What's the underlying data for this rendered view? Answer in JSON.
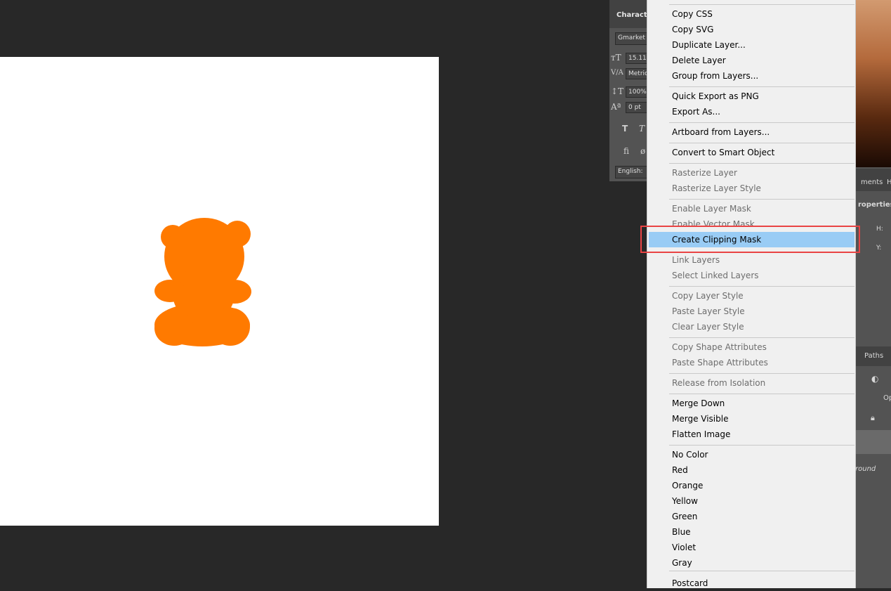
{
  "character_panel": {
    "tab_title": "Character",
    "font_family": "Gmarket S",
    "font_size": "15.11",
    "kerning": "Metric",
    "vertical_scale": "100%",
    "baseline_shift": "0 pt",
    "language": "English:"
  },
  "right_panel": {
    "adjustments_tab": "ments",
    "h_tab": "H",
    "properties_label": "roperties",
    "h_label": "H:",
    "y_label": "Y:",
    "paths_tab": "Paths",
    "opacity_label": "Op",
    "background_layer_label": "round"
  },
  "menu": {
    "items": [
      {
        "label": "Copy CSS",
        "enabled": true
      },
      {
        "label": "Copy SVG",
        "enabled": true
      },
      {
        "label": "Duplicate Layer...",
        "enabled": true
      },
      {
        "label": "Delete Layer",
        "enabled": true
      },
      {
        "label": "Group from Layers...",
        "enabled": true
      },
      {
        "label": "Quick Export as PNG",
        "enabled": true
      },
      {
        "label": "Export As...",
        "enabled": true
      },
      {
        "label": "Artboard from Layers...",
        "enabled": true
      },
      {
        "label": "Convert to Smart Object",
        "enabled": true
      },
      {
        "label": "Rasterize Layer",
        "enabled": false
      },
      {
        "label": "Rasterize Layer Style",
        "enabled": false
      },
      {
        "label": "Enable Layer Mask",
        "enabled": false
      },
      {
        "label": "Enable Vector Mask",
        "enabled": false
      },
      {
        "label": "Create Clipping Mask",
        "enabled": true,
        "highlighted": true
      },
      {
        "label": "Link Layers",
        "enabled": false
      },
      {
        "label": "Select Linked Layers",
        "enabled": false
      },
      {
        "label": "Copy Layer Style",
        "enabled": false
      },
      {
        "label": "Paste Layer Style",
        "enabled": false
      },
      {
        "label": "Clear Layer Style",
        "enabled": false
      },
      {
        "label": "Copy Shape Attributes",
        "enabled": false
      },
      {
        "label": "Paste Shape Attributes",
        "enabled": false
      },
      {
        "label": "Release from Isolation",
        "enabled": false
      },
      {
        "label": "Merge Down",
        "enabled": true
      },
      {
        "label": "Merge Visible",
        "enabled": true
      },
      {
        "label": "Flatten Image",
        "enabled": true
      },
      {
        "label": "No Color",
        "enabled": true
      },
      {
        "label": "Red",
        "enabled": true
      },
      {
        "label": "Orange",
        "enabled": true
      },
      {
        "label": "Yellow",
        "enabled": true
      },
      {
        "label": "Green",
        "enabled": true
      },
      {
        "label": "Blue",
        "enabled": true
      },
      {
        "label": "Violet",
        "enabled": true
      },
      {
        "label": "Gray",
        "enabled": true
      },
      {
        "label": "Postcard",
        "enabled": true
      }
    ]
  },
  "colors": {
    "shape_fill": "#ff7a00",
    "highlight": "#99ccf5",
    "focus_outline": "#e94444"
  }
}
